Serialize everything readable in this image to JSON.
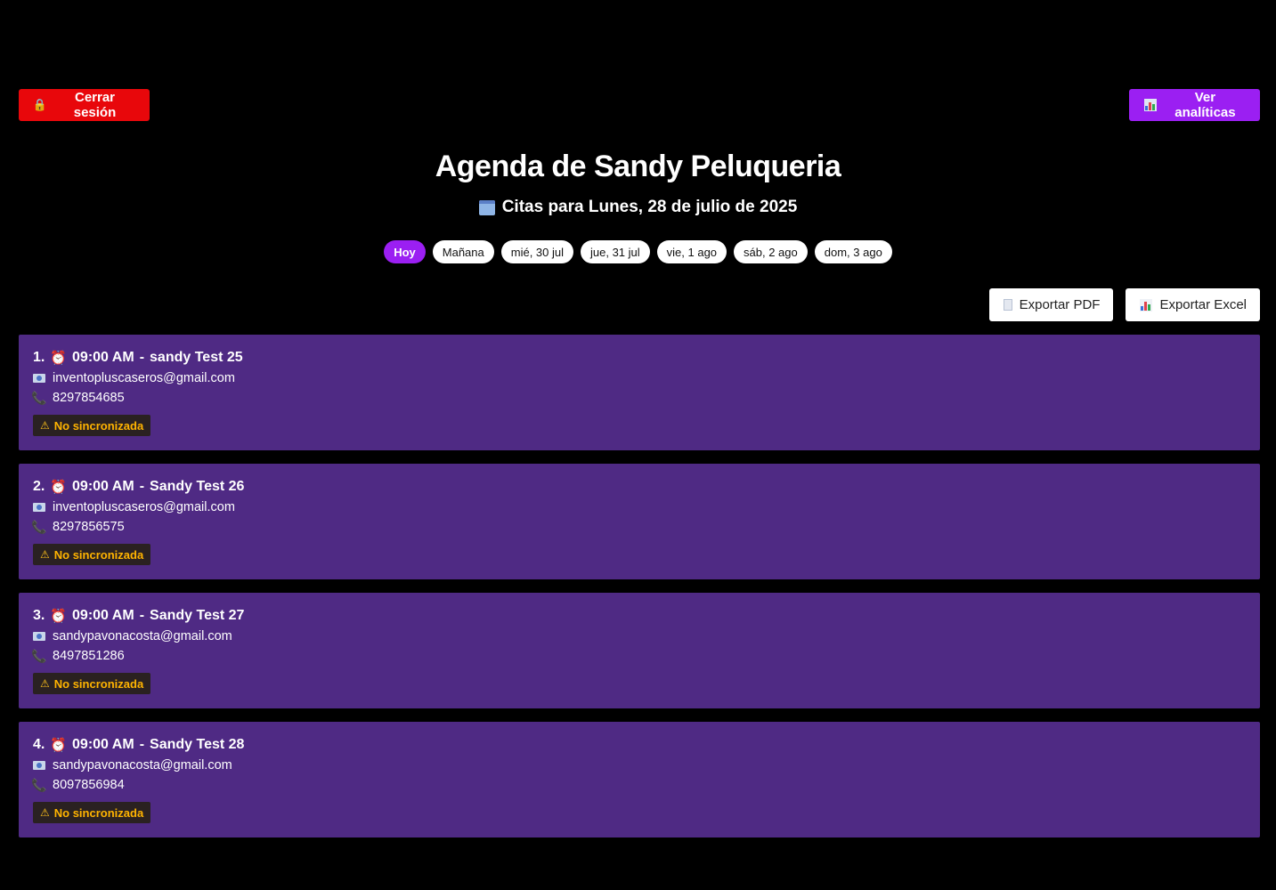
{
  "header": {
    "logout_label": "Cerrar sesión",
    "analytics_label": "Ver analíticas",
    "title": "Agenda de Sandy Peluqueria",
    "subtitle": "Citas para Lunes, 28 de julio de 2025"
  },
  "day_tabs": [
    {
      "label": "Hoy",
      "active": true
    },
    {
      "label": "Mañana",
      "active": false
    },
    {
      "label": "mié, 30 jul",
      "active": false
    },
    {
      "label": "jue, 31 jul",
      "active": false
    },
    {
      "label": "vie, 1 ago",
      "active": false
    },
    {
      "label": "sáb, 2 ago",
      "active": false
    },
    {
      "label": "dom, 3 ago",
      "active": false
    }
  ],
  "export": {
    "pdf_label": "Exportar PDF",
    "excel_label": "Exportar Excel"
  },
  "appointments": [
    {
      "index": "1.",
      "time": "09:00 AM",
      "name": "sandy Test 25",
      "email": "inventopluscaseros@gmail.com",
      "phone": "8297854685",
      "status": "No sincronizada"
    },
    {
      "index": "2.",
      "time": "09:00 AM",
      "name": "Sandy Test 26",
      "email": "inventopluscaseros@gmail.com",
      "phone": "8297856575",
      "status": "No sincronizada"
    },
    {
      "index": "3.",
      "time": "09:00 AM",
      "name": "Sandy Test 27",
      "email": "sandypavonacosta@gmail.com",
      "phone": "8497851286",
      "status": "No sincronizada"
    },
    {
      "index": "4.",
      "time": "09:00 AM",
      "name": "Sandy Test 28",
      "email": "sandypavonacosta@gmail.com",
      "phone": "8097856984",
      "status": "No sincronizada"
    }
  ],
  "colors": {
    "background": "#000000",
    "logout": "#e8070b",
    "accent": "#9b1ff2",
    "card": "#4f2a84",
    "warning": "#ffb400"
  },
  "icons": {
    "logout": "lock-icon",
    "analytics": "chart-icon",
    "subtitle": "calendar-icon",
    "pdf": "document-icon",
    "excel": "chart-icon",
    "time": "alarm-clock-icon",
    "email": "id-card-icon",
    "phone": "phone-icon",
    "status": "warning-icon"
  }
}
